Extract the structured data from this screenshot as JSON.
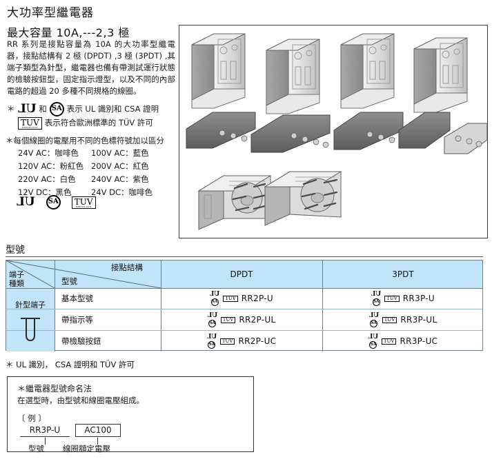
{
  "header": {
    "title": "大功率型繼電器",
    "subtitle": "最大容量 10A,---2,3 極",
    "intro": "RR 系列是接點容量為 10A 的大功率型繼電器，接點結構有 2 極 (DPDT) ,3 極 (3PDT) ,其端子類型為針型，繼電器也備有帶測試運行狀態的檢驗按鈕型，固定指示燈型，以及不同的內部電路的超過 20 多種不同規格的線圈。"
  },
  "cert_notes": {
    "line1_prefix": "＊",
    "line1_mid": "和",
    "line1_suffix": "表示 UL 識別和 CSA 證明",
    "line2_suffix": "表示符合歐洲標準的 TÜV 許可"
  },
  "coil": {
    "heading": "＊每個線圈的電壓用不同的色標符號加以區分",
    "rows": [
      {
        "left": "24V AC：咖啡色",
        "right": "100V AC：藍色"
      },
      {
        "left": "120V AC：粉紅色",
        "right": "200V AC：紅色"
      },
      {
        "left": "220V AC：白色",
        "right": "240V AC：紫色"
      },
      {
        "left": "12V DC：黑色",
        "right": "24V DC：咖啡色"
      }
    ]
  },
  "marks": {
    "ul": "UL",
    "csa": "SA",
    "tuv": "TUV",
    "tuv_sub": "RHEINLAND"
  },
  "photo": {
    "caption": "",
    "alt": "大功率型繼電器產品照片"
  },
  "models_section": {
    "title": "型號",
    "headers": {
      "terminal_kind": "端子\n種類",
      "terminal_kind_l1": "端子",
      "terminal_kind_l2": "種類",
      "contact_structure": "接點結構",
      "model_no": "型號",
      "col_dpdt": "DPDT",
      "col_3pdt": "3PDT"
    },
    "terminal_cell": {
      "label": "針型端子"
    },
    "rows": [
      {
        "name": "基本型號",
        "dpdt": "RR2P-U",
        "tpdt": "RR3P-U"
      },
      {
        "name": "帶指示等",
        "dpdt": "RR2P-UL",
        "tpdt": "RR3P-UL"
      },
      {
        "name": "帶檢驗按鈕",
        "dpdt": "RR2P-UC",
        "tpdt": "RR3P-UC"
      }
    ]
  },
  "footnote": "＊ UL 識別， CSA 證明和 TÜV 許可",
  "naming": {
    "title": "＊繼電器型號命名法",
    "subtitle": "在選型時，由型號和線圈電壓組成。",
    "example_label": "〔 例 〕",
    "model_value": "RR3P-U",
    "voltage_value": "AC100",
    "label_model": "型號",
    "label_voltage": "線圈額定電壓"
  },
  "colors": {
    "table_header_bg": "#c2e4f8",
    "table_border": "#6b7d87",
    "text": "#1a1a1a"
  }
}
